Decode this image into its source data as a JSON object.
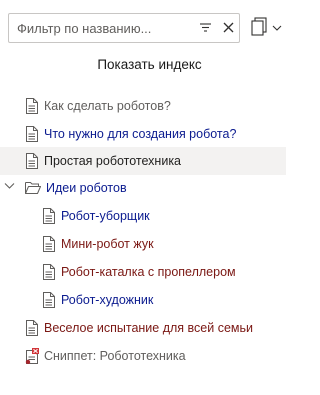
{
  "filter": {
    "placeholder": "Фильтр по названию...",
    "value": ""
  },
  "toolbar": {
    "show_index_label": "Показать индекс"
  },
  "icons": {
    "filter": "filter-icon",
    "clear": "close-icon",
    "copy": "copy-icon",
    "page": "page-icon",
    "folder": "folder-open-icon",
    "chevron": "chevron-down-icon",
    "snippet": "snippet-icon"
  },
  "colors": {
    "link_blue": "#0b1b8f",
    "link_red": "#7a1713",
    "text_gray": "#605e5c",
    "selected_bg": "#f3f2f1",
    "snippet_red": "#d13438"
  },
  "tree": [
    {
      "label": "Как сделать роботов?",
      "color": "gray"
    },
    {
      "label": "Что нужно для создания робота?",
      "color": "blue"
    },
    {
      "label": "Простая робототехника",
      "color": "dark",
      "selected": true
    },
    {
      "label": "Идеи роботов",
      "color": "blue",
      "expanded": true,
      "children": [
        {
          "label": "Робот-уборщик",
          "color": "blue"
        },
        {
          "label": "Мини-робот жук",
          "color": "red"
        },
        {
          "label": "Робот-каталка с пропеллером",
          "color": "red"
        },
        {
          "label": "Робот-художник",
          "color": "blue"
        }
      ]
    },
    {
      "label": "Веселое испытание для всей семьи",
      "color": "red"
    },
    {
      "label": "Сниппет: Робототехника",
      "color": "gray",
      "snippet": true
    }
  ]
}
